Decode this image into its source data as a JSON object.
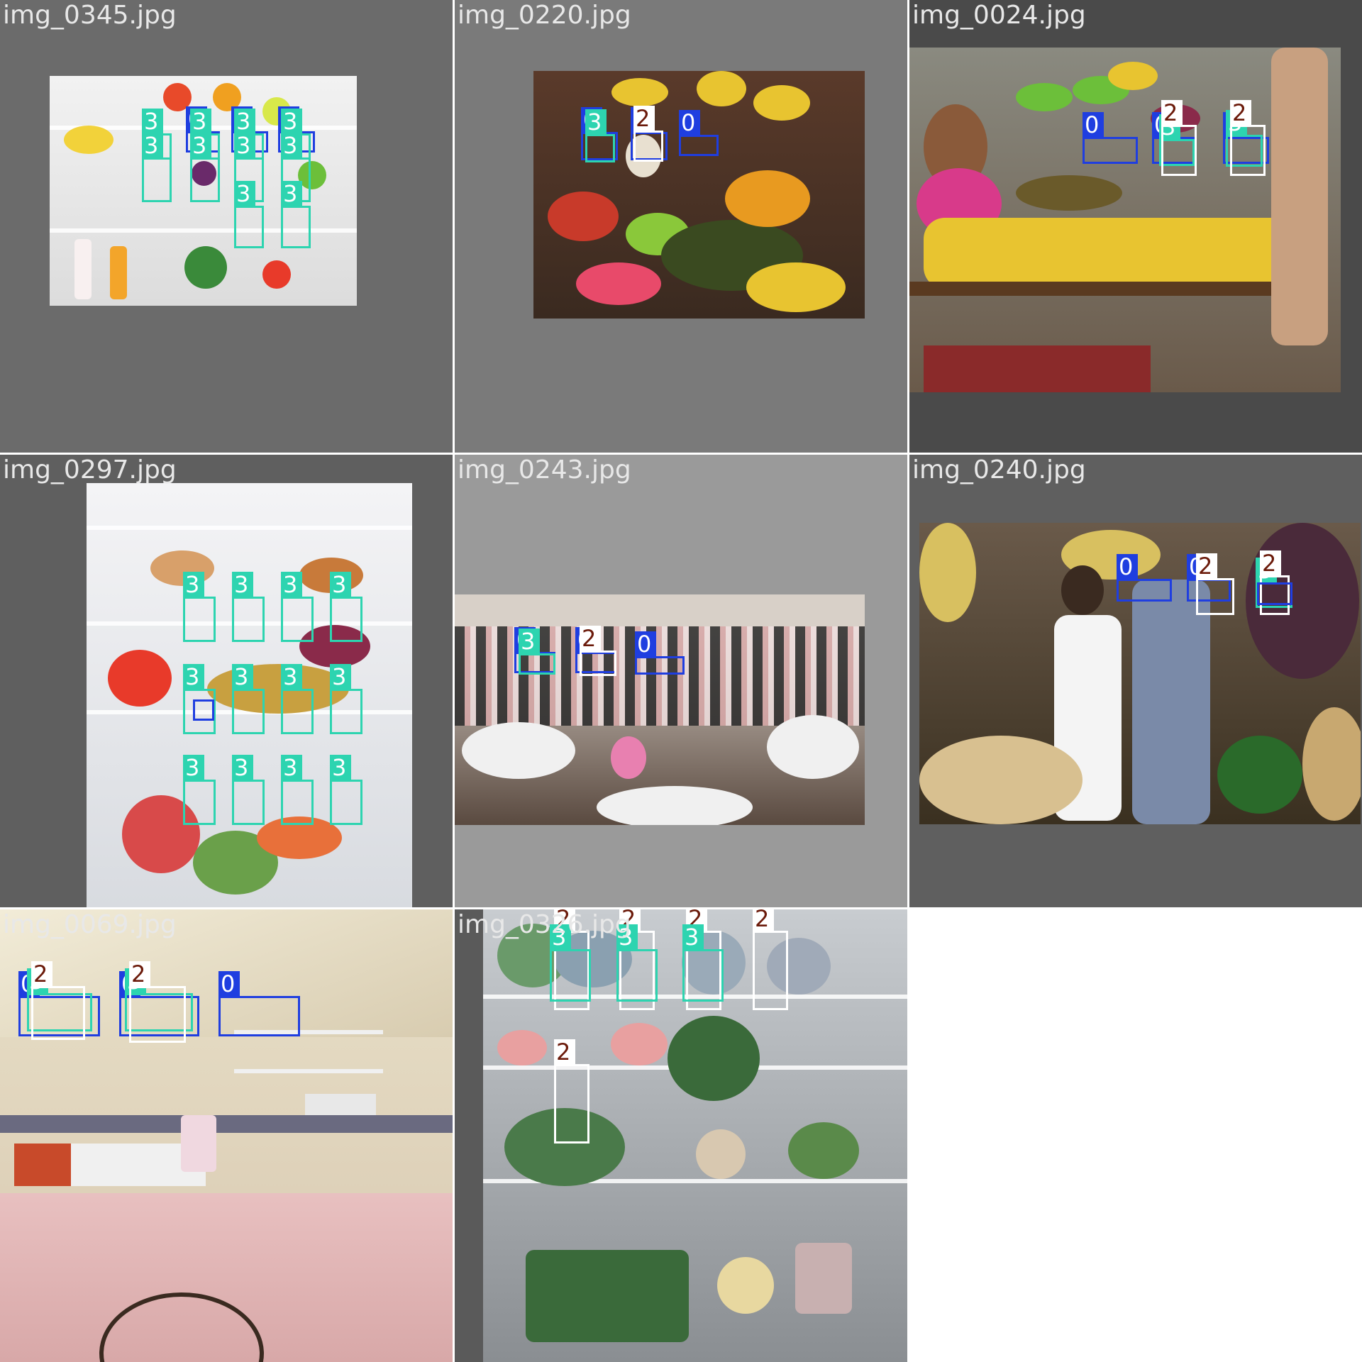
{
  "grid": {
    "background": "#ffffff",
    "tiles": [
      {
        "filename": "img_0345.jpg",
        "bg": "#6b6b6b"
      },
      {
        "filename": "img_0220.jpg",
        "bg": "#7a7a7a"
      },
      {
        "filename": "img_0024.jpg",
        "bg": "#4a4a4a"
      },
      {
        "filename": "img_0297.jpg",
        "bg": "#5f5f5f"
      },
      {
        "filename": "img_0243.jpg",
        "bg": "#9a9a9a"
      },
      {
        "filename": "img_0240.jpg",
        "bg": "#5f5f5f"
      },
      {
        "filename": "img_0069.jpg",
        "bg": "#cfc8b0"
      },
      {
        "filename": "img_0326.jpg",
        "bg": "#5a5a5a"
      }
    ]
  },
  "label_colors": {
    "0": "#1f3ee0",
    "2": "#ffffff",
    "3": "#2dd4b0"
  },
  "labels": {
    "c0": "0",
    "c2": "2",
    "c3": "3"
  }
}
